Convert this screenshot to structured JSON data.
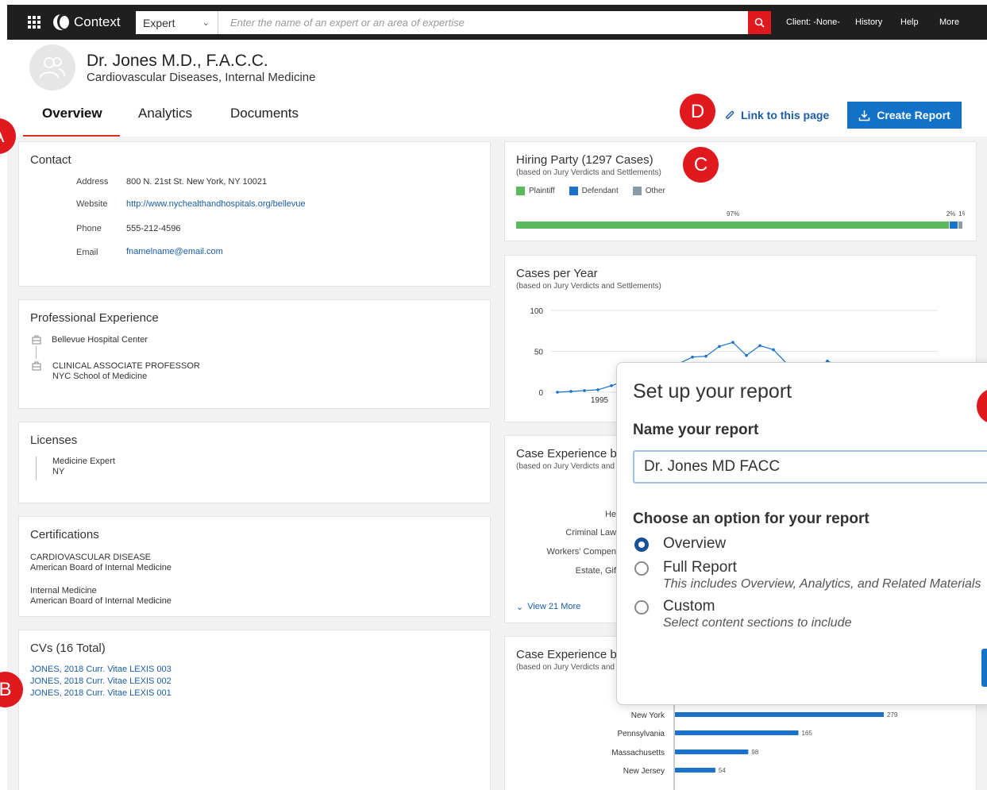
{
  "topnav": {
    "app_name": "Context",
    "search_type": "Expert",
    "search_placeholder": "Enter the name of an expert or an area of expertise",
    "client": "Client: -None-",
    "history": "History",
    "help": "Help",
    "more": "More"
  },
  "profile": {
    "name": "Dr. Jones M.D., F.A.C.C.",
    "specialties": "Cardiovascular Diseases, Internal Medicine"
  },
  "tabs": [
    {
      "label": "Overview",
      "active": true
    },
    {
      "label": "Analytics",
      "active": false
    },
    {
      "label": "Documents",
      "active": false
    }
  ],
  "actions": {
    "link_page": "Link to this page",
    "create_report": "Create Report"
  },
  "markers": {
    "a": "A",
    "b": "B",
    "c": "C",
    "d": "D"
  },
  "contact": {
    "title": "Contact",
    "address_label": "Address",
    "address": "800 N. 21st St. New York, NY 10021",
    "website_label": "Website",
    "website": "http://www.nychealthandhospitals.org/bellevue",
    "phone_label": "Phone",
    "phone": "555-212-4596",
    "email_label": "Email",
    "email": "fnamelname@email.com"
  },
  "experience": {
    "title": "Professional Experience",
    "items": [
      {
        "line1": "Bellevue Hospital Center",
        "line2": ""
      },
      {
        "line1": "CLINICAL ASSOCIATE PROFESSOR",
        "line2": "NYC School of Medicine"
      }
    ]
  },
  "licenses": {
    "title": "Licenses",
    "line1": "Medicine Expert",
    "line2": "NY"
  },
  "certifications": {
    "title": "Certifications",
    "items": [
      {
        "line1": "CARDIOVASCULAR DISEASE",
        "line2": "American Board of Internal Medicine"
      },
      {
        "line1": "Internal Medicine",
        "line2": "American Board of Internal Medicine"
      }
    ]
  },
  "cvs": {
    "title": "CVs (16 Total)",
    "items": [
      "JONES, 2018 Curr. Vitae LEXIS 003",
      "JONES, 2018 Curr. Vitae LEXIS 002",
      "JONES, 2018 Curr. Vitae LEXIS 001"
    ]
  },
  "hiring_party": {
    "title": "Hiring Party (1297 Cases)",
    "subtitle": "(based on Jury Verdicts and Settlements)",
    "legend": [
      "Plaintiff",
      "Defendant",
      "Other"
    ],
    "colors": {
      "plaintiff": "#5cb85c",
      "defendant": "#1a73c9",
      "other": "#8c9aa6"
    },
    "labels": [
      "97%",
      "2%",
      "1%"
    ]
  },
  "cases_per_year": {
    "title": "Cases per Year",
    "subtitle": "(based on Jury Verdicts and Settlements)"
  },
  "case_exp_1": {
    "title": "Case Experience by",
    "subtitle": "(based on Jury Verdicts and",
    "view_more": "View 21 More",
    "categories": [
      "He",
      "Criminal Law",
      "Workers' Compen",
      "Estate, Gif"
    ]
  },
  "case_exp_2": {
    "title": "Case Experience by",
    "subtitle": "(based on Jury Verdicts and"
  },
  "chart_data": [
    {
      "type": "bar",
      "title": "Hiring Party (1297 Cases)",
      "orientation": "horizontal-stacked",
      "series": [
        {
          "name": "Plaintiff",
          "values": [
            97
          ]
        },
        {
          "name": "Defendant",
          "values": [
            2
          ]
        },
        {
          "name": "Other",
          "values": [
            1
          ]
        }
      ],
      "unit": "%"
    },
    {
      "type": "line",
      "title": "Cases per Year",
      "yticks": [
        0,
        50,
        100
      ],
      "ylim": [
        0,
        100
      ],
      "xtick_labels": [
        "1995"
      ],
      "values": [
        0,
        1,
        2,
        3,
        8,
        14,
        19,
        24,
        28,
        35,
        43,
        44,
        56,
        61,
        45,
        57,
        52,
        35,
        30,
        28,
        38,
        32
      ]
    },
    {
      "type": "bar",
      "title": "Case Experience by",
      "orientation": "horizontal",
      "categories": [
        "New York",
        "Pennsylvania",
        "Massachusetts",
        "New Jersey"
      ],
      "values": [
        279,
        165,
        98,
        54
      ]
    }
  ],
  "modal": {
    "title": "Set up your report",
    "name_label": "Name your report",
    "name_value": "Dr. Jones MD FACC",
    "choose_label": "Choose an option for your report",
    "options": [
      {
        "label": "Overview",
        "desc": "",
        "checked": true
      },
      {
        "label": "Full Report",
        "desc": "This includes Overview, Analytics, and Related Materials",
        "checked": false
      },
      {
        "label": "Custom",
        "desc": "Select content sections to include",
        "checked": false
      }
    ]
  }
}
